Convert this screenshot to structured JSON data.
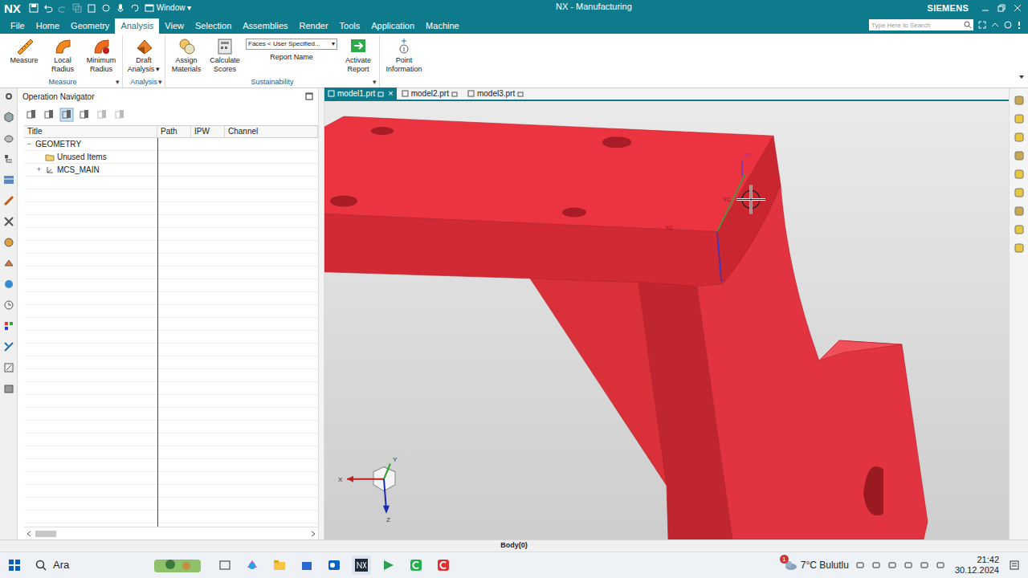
{
  "window": {
    "logo": "NX",
    "title": "NX - Manufacturing",
    "brand": "SIEMENS",
    "window_menu": "Window ▾"
  },
  "menu_tabs": [
    {
      "label": "File",
      "selected": false
    },
    {
      "label": "Home",
      "selected": false
    },
    {
      "label": "Geometry",
      "selected": false
    },
    {
      "label": "Analysis",
      "selected": true
    },
    {
      "label": "View",
      "selected": false
    },
    {
      "label": "Selection",
      "selected": false
    },
    {
      "label": "Assemblies",
      "selected": false
    },
    {
      "label": "Render",
      "selected": false
    },
    {
      "label": "Tools",
      "selected": false
    },
    {
      "label": "Application",
      "selected": false
    },
    {
      "label": "Machine",
      "selected": false
    }
  ],
  "search": {
    "placeholder": "Type Here to Search"
  },
  "ribbon": {
    "groups": [
      {
        "label": "Measure",
        "caret": "▾",
        "items": [
          {
            "kind": "button",
            "label": "Measure"
          },
          {
            "kind": "button",
            "label": "Local Radius"
          },
          {
            "kind": "button",
            "label": "Minimum Radius"
          }
        ]
      },
      {
        "label": "Analysis",
        "caret": "▾",
        "items": [
          {
            "kind": "button",
            "label": "Draft Analysis",
            "caret": "▾"
          }
        ]
      },
      {
        "label": "Sustainability",
        "caret": "▾",
        "items": [
          {
            "kind": "button",
            "label": "Assign Materials"
          },
          {
            "kind": "button",
            "label": "Calculate Scores"
          },
          {
            "kind": "dropdown",
            "value": "Faces < User Specified...",
            "caret": "▾",
            "label": "Report Name"
          },
          {
            "kind": "button",
            "label": "Activate Report"
          }
        ]
      }
    ],
    "standalone": [
      {
        "label": "Point Information"
      }
    ]
  },
  "navigator": {
    "title": "Operation Navigator",
    "columns": [
      "Title",
      "Path",
      "IPW",
      "Channel"
    ],
    "rows": [
      {
        "label": "GEOMETRY",
        "depth": 0,
        "kind": "root",
        "toggle": "−",
        "expanded": true
      },
      {
        "label": "Unused Items",
        "depth": 1,
        "kind": "folder"
      },
      {
        "label": "MCS_MAIN",
        "depth": 1,
        "kind": "mcs",
        "toggle": "+",
        "expanded": false
      }
    ]
  },
  "doc_tabs": [
    {
      "label": "model1.prt",
      "selected": true,
      "close": "×"
    },
    {
      "label": "model2.prt",
      "selected": false
    },
    {
      "label": "model3.prt",
      "selected": false
    }
  ],
  "viewport": {
    "wcs_labels": [
      "ZC",
      "YC",
      "XC"
    ],
    "triad_labels": [
      "X",
      "Y",
      "Z"
    ]
  },
  "status_bar": {
    "text": "Body(0)"
  },
  "taskbar": {
    "search": "Ara",
    "weather_badge": "1",
    "weather": "7°C Bulutlu",
    "time": "21:42",
    "date": "30.12.2024"
  }
}
